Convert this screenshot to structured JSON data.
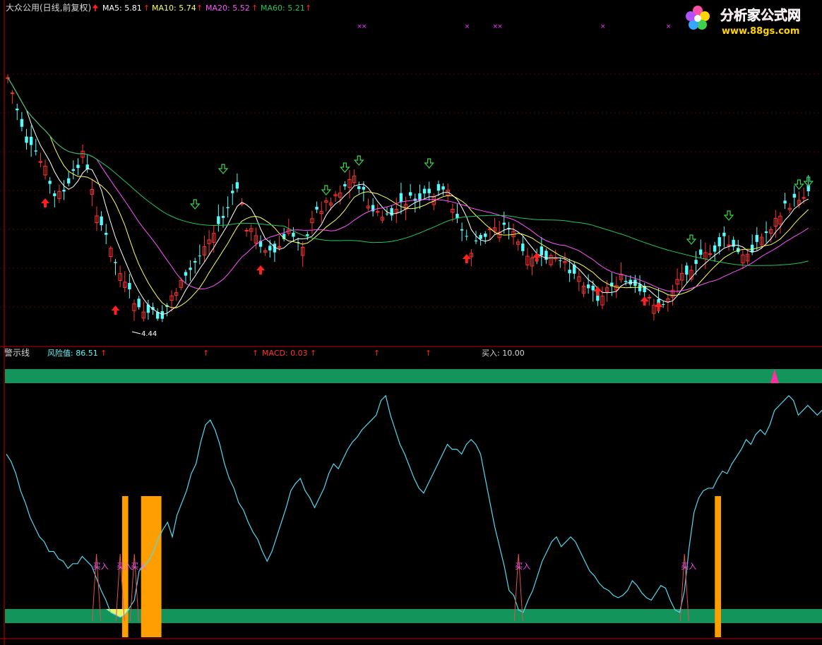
{
  "header": {
    "stock": "大众公用(日线,前复权)",
    "ma5": "MA5: 5.81",
    "ma10": "MA10: 5.74",
    "ma20": "MA20: 5.52",
    "ma60": "MA60: 5.21"
  },
  "watermark": {
    "line1": "分析家公式网",
    "line2": "www.88gs.com"
  },
  "lower": {
    "title": "警示线",
    "risk": "风险值: 86.51",
    "macd": "MACD: 0.03",
    "buy": "买入: 10.00",
    "buy_label": "买入"
  },
  "colors": {
    "ma5": "#ffffff",
    "ma10": "#ffff55",
    "ma20": "#ff55ff",
    "ma60": "#22c55e",
    "up": "#ff3232",
    "down": "#54fcfc",
    "band": "#13945b",
    "bar": "#ff9e00"
  },
  "chart_data": [
    {
      "type": "candlestick",
      "name": "price",
      "low_marker": "4.44",
      "legend": [
        "MA5",
        "MA10",
        "MA20",
        "MA60"
      ]
    },
    {
      "type": "line",
      "name": "risk",
      "ylim": [
        0,
        100
      ],
      "band_levels": [
        10,
        90
      ],
      "values": [
        70,
        67,
        62,
        55,
        50,
        44,
        40,
        36,
        34,
        30,
        30,
        27,
        26,
        23,
        25,
        25,
        28,
        26,
        24,
        19,
        14,
        10,
        5,
        4,
        3,
        4,
        7,
        10,
        22,
        24,
        26,
        30,
        35,
        39,
        42,
        36,
        45,
        50,
        55,
        62,
        66,
        75,
        82,
        84,
        80,
        74,
        66,
        60,
        56,
        50,
        47,
        42,
        38,
        35,
        30,
        26,
        30,
        36,
        42,
        48,
        55,
        58,
        60,
        55,
        52,
        48,
        52,
        56,
        62,
        66,
        64,
        68,
        72,
        75,
        77,
        80,
        82,
        84,
        86,
        92,
        94,
        86,
        80,
        74,
        70,
        65,
        60,
        56,
        54,
        58,
        62,
        66,
        70,
        74,
        72,
        72,
        70,
        74,
        76,
        74,
        70,
        60,
        50,
        40,
        32,
        24,
        14,
        12,
        6,
        5,
        10,
        14,
        20,
        26,
        30,
        34,
        36,
        32,
        34,
        36,
        34,
        30,
        26,
        22,
        20,
        17,
        15,
        14,
        12,
        11,
        12,
        14,
        18,
        16,
        13,
        11,
        10,
        13,
        16,
        15,
        10,
        6,
        5,
        14,
        32,
        46,
        52,
        55,
        56,
        56,
        60,
        63,
        62,
        66,
        69,
        72,
        76,
        74,
        78,
        80,
        78,
        82,
        88,
        90,
        92,
        94,
        92,
        86,
        88,
        90,
        88,
        86,
        88
      ],
      "buy_signals": [
        19,
        24,
        27,
        108,
        143
      ],
      "buy_bars": [
        25,
        29,
        30,
        31,
        32,
        150
      ]
    }
  ]
}
